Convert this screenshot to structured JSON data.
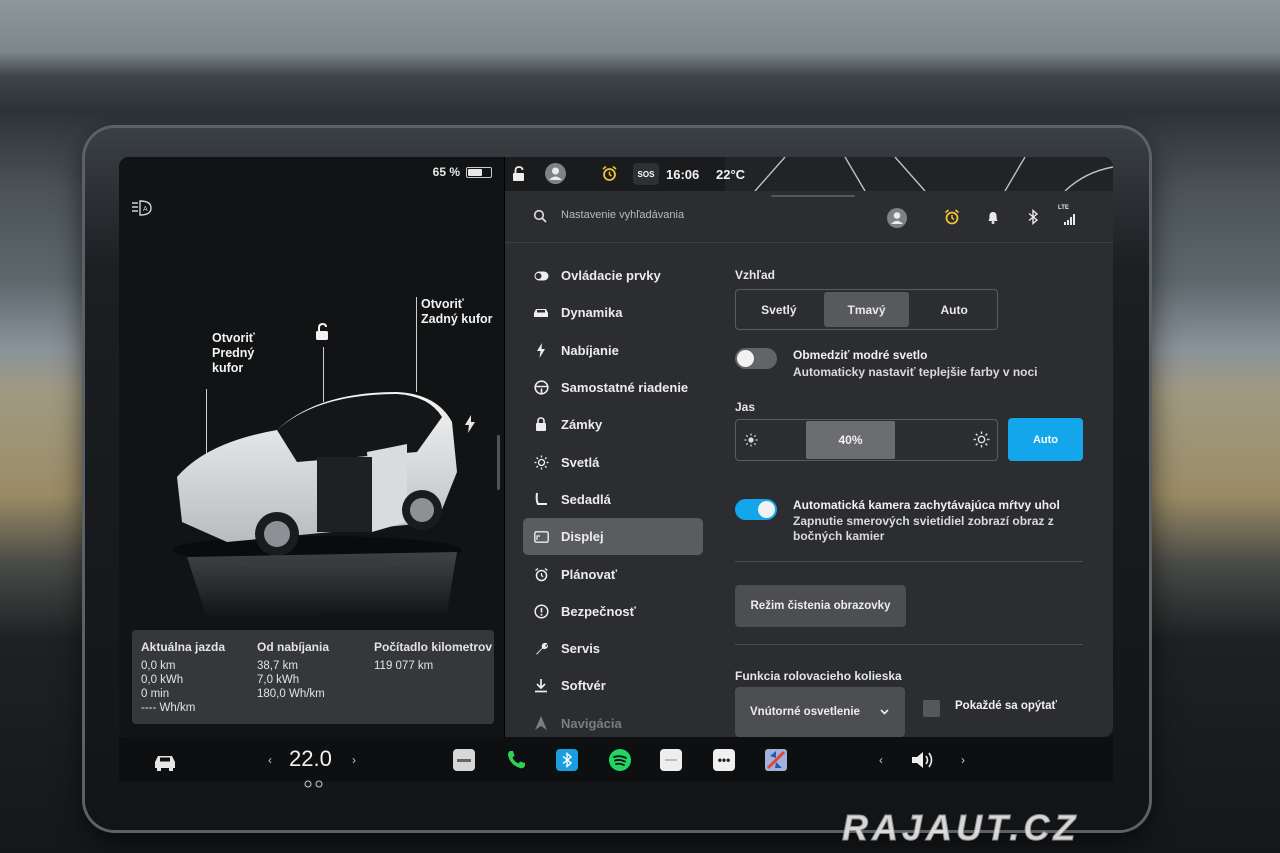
{
  "status_left": {
    "battery": "65 %",
    "battery_level": 0.65
  },
  "car_view": {
    "frunk_label": "Otvoriť\nPredný\nkufor",
    "trunk_label": "Otvoriť\nZadný kufor"
  },
  "trip": {
    "current": {
      "title": "Aktuálna jazda",
      "lines": [
        "0,0 km",
        "0,0 kWh",
        "0 min",
        "---- Wh/km"
      ]
    },
    "since_charge": {
      "title": "Od nabíjania",
      "lines": [
        "38,7 km",
        "7,0 kWh",
        "180,0 Wh/km"
      ]
    },
    "odometer": {
      "title": "Počítadlo kilometrov",
      "lines": [
        "119 077 km"
      ]
    }
  },
  "status_right": {
    "sos": "SOS",
    "time": "16:06",
    "temperature": "22°C"
  },
  "search": {
    "placeholder": "Nastavenie vyhľadávania",
    "lte": "LTE"
  },
  "menu": [
    {
      "label": "Ovládacie prvky",
      "icon": "toggle-icon"
    },
    {
      "label": "Dynamika",
      "icon": "car-icon"
    },
    {
      "label": "Nabíjanie",
      "icon": "bolt-icon"
    },
    {
      "label": "Samostatné riadenie",
      "icon": "steering-wheel-icon"
    },
    {
      "label": "Zámky",
      "icon": "lock-icon"
    },
    {
      "label": "Svetlá",
      "icon": "sun-icon"
    },
    {
      "label": "Sedadlá",
      "icon": "seat-icon"
    },
    {
      "label": "Displej",
      "icon": "display-icon",
      "active": true
    },
    {
      "label": "Plánovať",
      "icon": "alarm-icon"
    },
    {
      "label": "Bezpečnosť",
      "icon": "alert-icon"
    },
    {
      "label": "Servis",
      "icon": "wrench-icon"
    },
    {
      "label": "Softvér",
      "icon": "download-icon"
    },
    {
      "label": "Navigácia",
      "icon": "navigation-icon"
    }
  ],
  "display": {
    "appearance": {
      "label": "Vzhľad",
      "options": [
        "Svetlý",
        "Tmavý",
        "Auto"
      ],
      "selected": "Tmavý"
    },
    "blue_light": {
      "title": "Obmedziť modré svetlo",
      "subtitle": "Automaticky nastaviť teplejšie farby v noci",
      "on": false
    },
    "brightness": {
      "label": "Jas",
      "value": "40%",
      "level": 0.4,
      "auto": "Auto"
    },
    "blind_spot": {
      "title": "Automatická kamera zachytávajúca mŕtvy uhol",
      "subtitle": "Zapnutie smerových svietidiel zobrazí obraz z bočných kamier",
      "on": true
    },
    "clean_mode": "Režim čistenia obrazovky",
    "scroll_wheel": {
      "label": "Funkcia rolovacieho kolieska",
      "value": "Vnútorné osvetlenie",
      "ask_label": "Pokaždé sa opýtať"
    }
  },
  "taskbar": {
    "temperature": "22.0"
  },
  "watermark": "RAJAUT.CZ",
  "colors": {
    "accent": "#13a6ea",
    "panel": "#2c2d30",
    "left_bg": "#111315"
  }
}
